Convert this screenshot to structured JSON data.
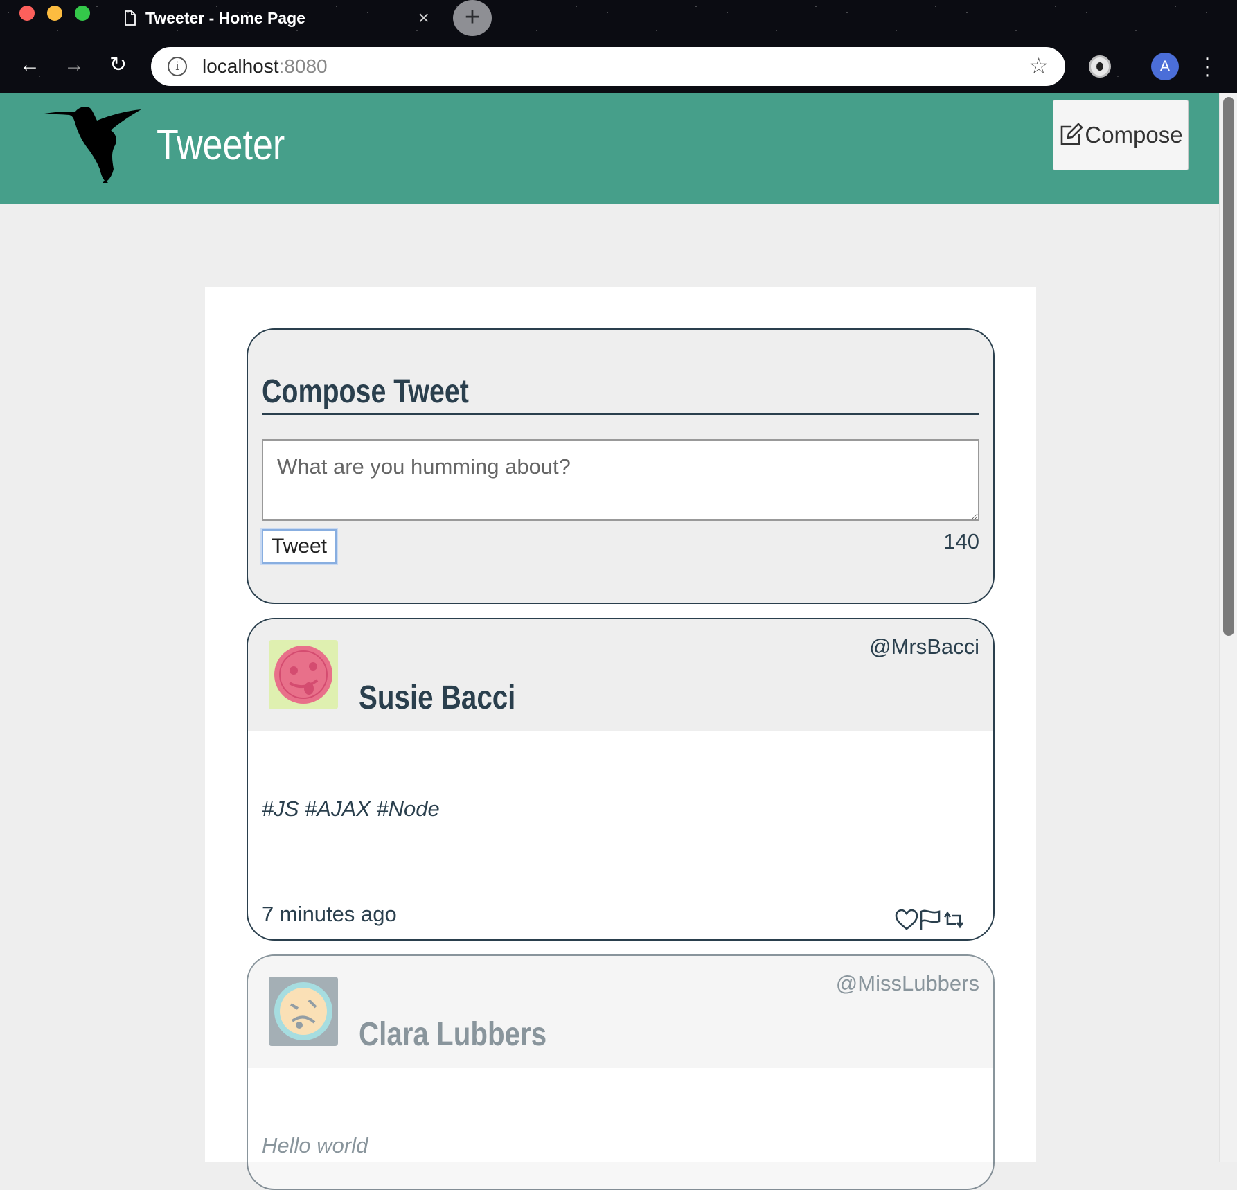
{
  "browser": {
    "tab_title": "Tweeter - Home Page",
    "tab_close": "×",
    "new_tab": "+",
    "url_host": "localhost",
    "url_port": ":8080",
    "profile_initial": "A"
  },
  "header": {
    "brand": "Tweeter",
    "compose_label": "Compose"
  },
  "new_tweet": {
    "title": "Compose Tweet",
    "placeholder": "What are you humming about?",
    "button_label": "Tweet",
    "counter": "140"
  },
  "tweets": [
    {
      "name": "Susie Bacci",
      "handle": "@MrsBacci",
      "content": "#JS #AJAX #Node",
      "time": "7 minutes ago",
      "avatar_bg": "#dff0b0",
      "avatar_face": "#e8708a"
    },
    {
      "name": "Clara Lubbers",
      "handle": "@MissLubbers",
      "content": "Hello world",
      "avatar_bg": "#5b6e7a",
      "avatar_face": "#f7c77c"
    }
  ],
  "colors": {
    "header_bg": "#469f8a",
    "text_dark": "#2a3f4d",
    "page_bg": "#eeeeee"
  },
  "icons": {
    "compose": "edit-icon",
    "like": "heart-icon",
    "flag": "flag-icon",
    "retweet": "retweet-icon",
    "logo": "hummingbird-icon"
  }
}
